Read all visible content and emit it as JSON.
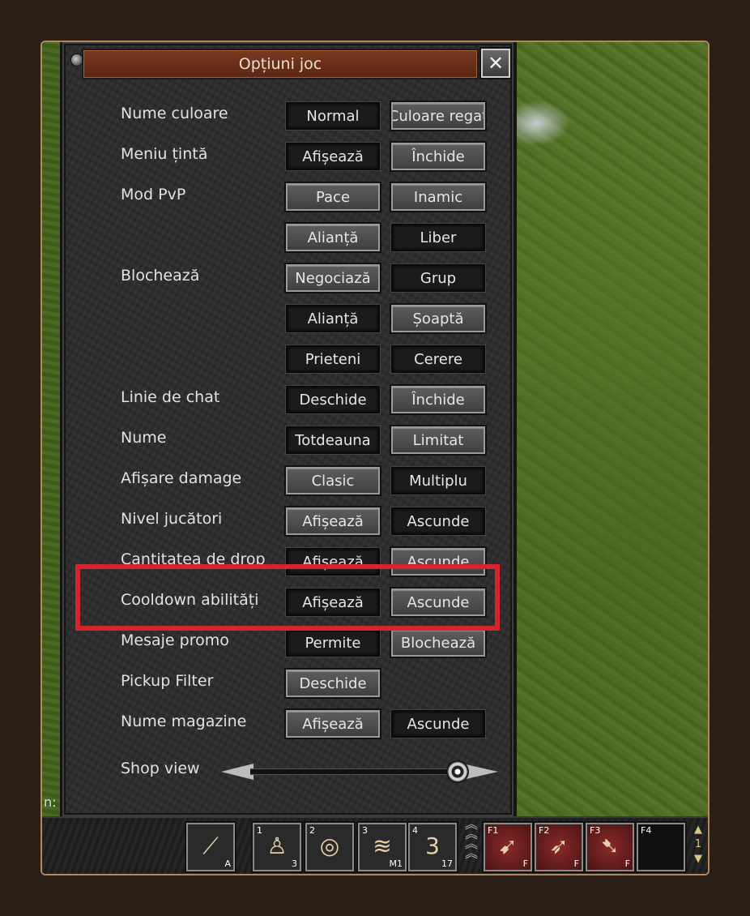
{
  "window": {
    "title": "Opțiuni joc",
    "close_symbol": "✕"
  },
  "left_label": "n:",
  "rows": [
    {
      "label": "Nume culoare",
      "opt1": "Normal",
      "opt2": "Culoare regat"
    },
    {
      "label": "Meniu țintă",
      "opt1": "Afișează",
      "opt2": "Închide"
    },
    {
      "label": "Mod PvP",
      "opt1": "Pace",
      "opt2": "Inamic"
    },
    {
      "label": "",
      "opt1": "Alianță",
      "opt2": "Liber"
    },
    {
      "label": "Blochează",
      "opt1": "Negociază",
      "opt2": "Grup"
    },
    {
      "label": "",
      "opt1": "Alianță",
      "opt2": "Șoaptă"
    },
    {
      "label": "",
      "opt1": "Prieteni",
      "opt2": "Cerere"
    },
    {
      "label": "Linie de chat",
      "opt1": "Deschide",
      "opt2": "Închide"
    },
    {
      "label": "Nume",
      "opt1": "Totdeauna",
      "opt2": "Limitat"
    },
    {
      "label": "Afișare damage",
      "opt1": "Clasic",
      "opt2": "Multiplu"
    },
    {
      "label": "Nivel jucători",
      "opt1": "Afișează",
      "opt2": "Ascunde"
    },
    {
      "label": "Cantitatea de drop",
      "opt1": "Afișează",
      "opt2": "Ascunde"
    },
    {
      "label": "Cooldown abilități",
      "opt1": "Afișează",
      "opt2": "Ascunde"
    },
    {
      "label": "Mesaje promo",
      "opt1": "Permite",
      "opt2": "Blochează"
    },
    {
      "label": "Pickup Filter",
      "opt1": "Deschide"
    },
    {
      "label": "Nume magazine",
      "opt1": "Afișează",
      "opt2": "Ascunde"
    }
  ],
  "shop_view": {
    "label": "Shop view"
  },
  "taskbar": {
    "slot0": {
      "icon": "sword-icon",
      "sub": "A"
    },
    "slot1": {
      "num": "1",
      "sub": "3",
      "icon": "statue-icon"
    },
    "slot2": {
      "num": "2",
      "icon": "ring-icon"
    },
    "slot3": {
      "num": "3",
      "sub": "M1",
      "icon": "claw-icon"
    },
    "slot4": {
      "num": "4",
      "center": "3",
      "sub": "17",
      "icon": "arrows-icon"
    },
    "slotF1": {
      "num": "F1",
      "sub": "F",
      "icon": "bow-icon"
    },
    "slotF2": {
      "num": "F2",
      "sub": "F",
      "icon": "bow-icon"
    },
    "slotF3": {
      "num": "F3",
      "sub": "F",
      "icon": "bow-icon"
    },
    "slotF4": {
      "num": "F4"
    },
    "page_number": "1"
  },
  "colors": {
    "highlight": "#d6232c",
    "titlebar": "#6a2e18",
    "frame": "#b08a5a"
  }
}
